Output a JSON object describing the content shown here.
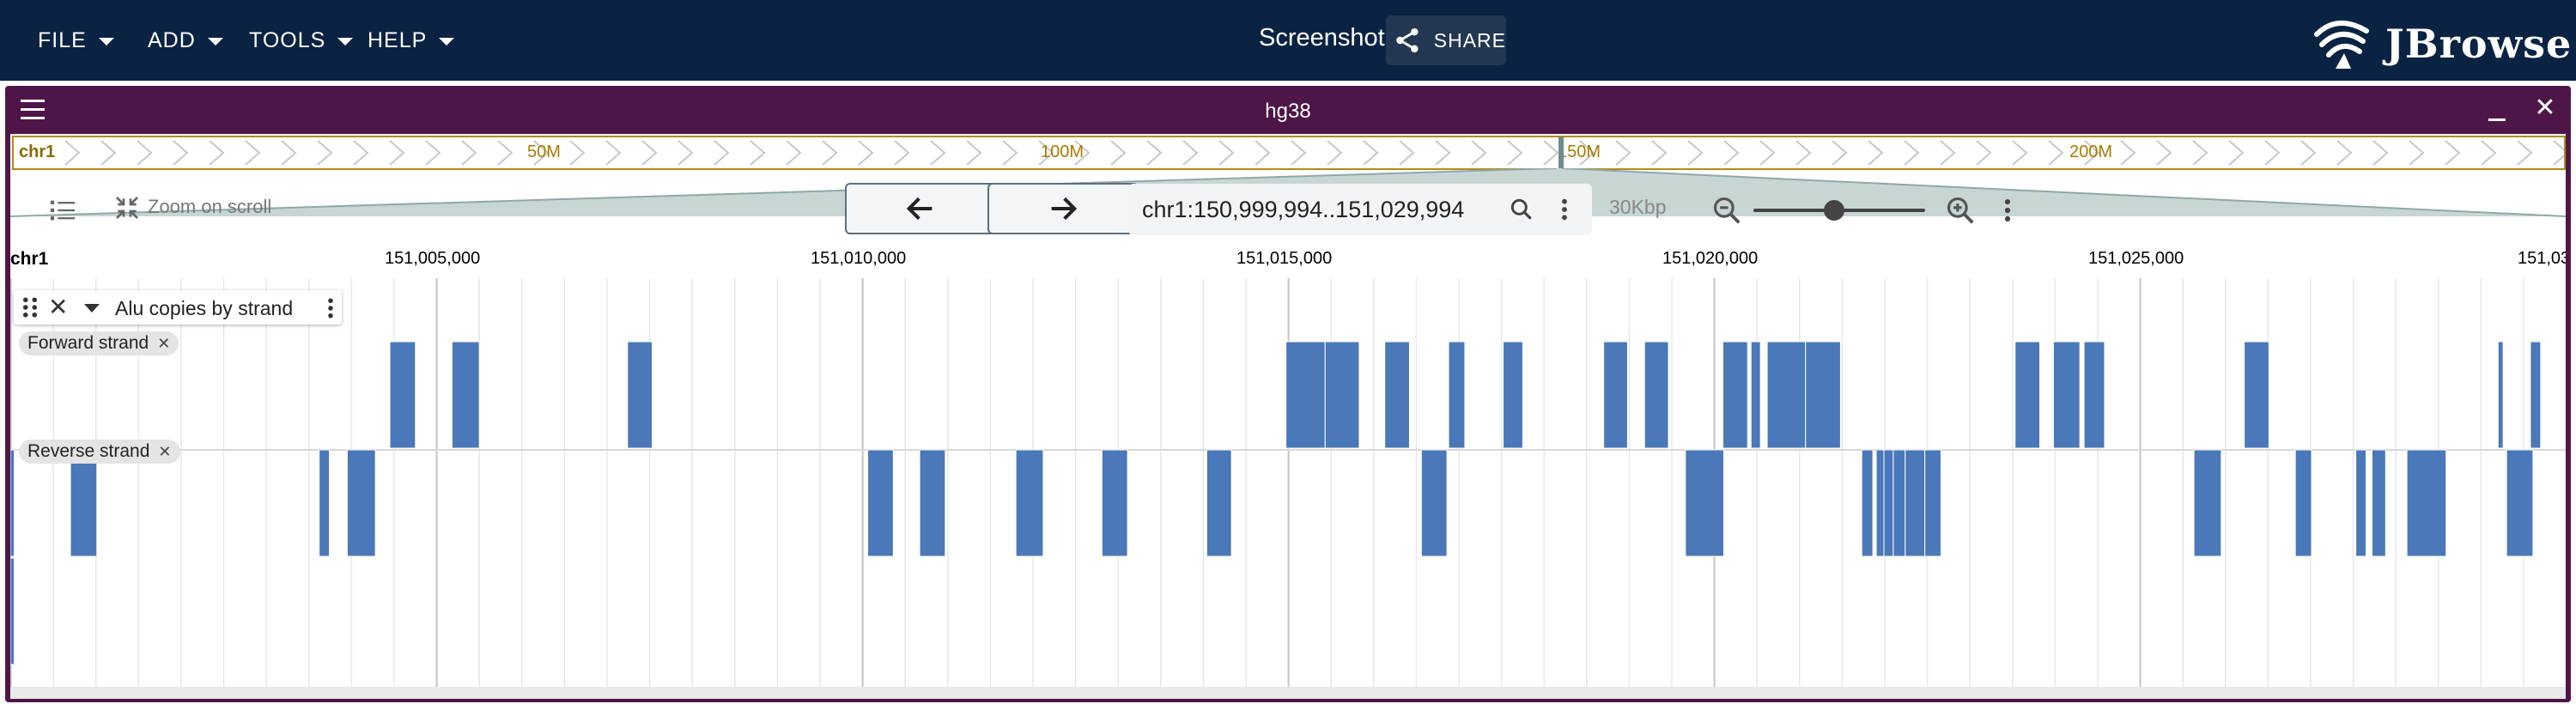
{
  "header": {
    "menus": [
      {
        "label": "FILE",
        "name": "file-menu"
      },
      {
        "label": "ADD",
        "name": "add-menu"
      },
      {
        "label": "TOOLS",
        "name": "tools-menu"
      },
      {
        "label": "HELP",
        "name": "help-menu"
      }
    ],
    "session_name": "Screenshot",
    "share_label": "SHARE",
    "logo_text": "JBrowse"
  },
  "view": {
    "assembly": "hg38",
    "overview": {
      "chr": "chr1",
      "ticks": [
        {
          "label": "50M",
          "pos": 50
        },
        {
          "label": "100M",
          "pos": 100
        },
        {
          "label": "150M",
          "pos": 150
        },
        {
          "label": "200M",
          "pos": 200
        }
      ]
    },
    "zoom_on_scroll_label": "Zoom on scroll",
    "location": "chr1:150,999,994..151,029,994",
    "bp_per_view_label": "30Kbp",
    "zoom_level": 0.42,
    "scale": {
      "chr": "chr1",
      "labels": [
        "151,005,000",
        "151,010,000",
        "151,015,000",
        "151,020,000",
        "151,025,000",
        "151,03"
      ]
    },
    "track": {
      "name": "Alu copies by strand",
      "feature_color": "#4a78b8",
      "subtracks": [
        {
          "label": "Forward strand"
        },
        {
          "label": "Reverse strand"
        }
      ]
    }
  },
  "colors": {
    "appbar": "#0b2343",
    "view_header": "#4e1648",
    "overview_border": "#b38b19",
    "feature": "#4a78b8"
  },
  "chart_data": {
    "type": "table",
    "xlim": [
      150999994,
      151029994
    ],
    "forward_features": [
      [
        151004450,
        151004750
      ],
      [
        151005180,
        151005500
      ],
      [
        151007240,
        151007530
      ],
      [
        151014970,
        151015430
      ],
      [
        151015430,
        151015830
      ],
      [
        151016130,
        151016420
      ],
      [
        151016880,
        151017070
      ],
      [
        151017520,
        151017750
      ],
      [
        151018700,
        151018980
      ],
      [
        151019180,
        151019460
      ],
      [
        151020100,
        151020390
      ],
      [
        151020430,
        151020540
      ],
      [
        151020620,
        151021070
      ],
      [
        151021070,
        151021480
      ],
      [
        151023530,
        151023820
      ],
      [
        151023980,
        151024290
      ],
      [
        151024340,
        151024580
      ],
      [
        151026220,
        151026510
      ],
      [
        151029200,
        151029260
      ],
      [
        151029580,
        151029700
      ]
    ],
    "reverse_features": [
      [
        150999994,
        151000040
      ],
      [
        151000700,
        151001010
      ],
      [
        151003620,
        151003740
      ],
      [
        151003950,
        151004280
      ],
      [
        151010060,
        151010360
      ],
      [
        151010670,
        151010970
      ],
      [
        151011800,
        151012120
      ],
      [
        151012810,
        151013110
      ],
      [
        151014040,
        151014330
      ],
      [
        151016560,
        151016860
      ],
      [
        151019660,
        151020110
      ],
      [
        151021730,
        151021860
      ],
      [
        151021900,
        151021990
      ],
      [
        151021990,
        151022100
      ],
      [
        151022100,
        151022240
      ],
      [
        151022240,
        151022470
      ],
      [
        151022470,
        151022660
      ],
      [
        151025630,
        151025950
      ],
      [
        151026820,
        151027010
      ],
      [
        151027530,
        151027650
      ],
      [
        151027720,
        151027880
      ],
      [
        151028130,
        151028590
      ],
      [
        151029300,
        151029610
      ]
    ],
    "extra_row_features": [
      [
        150999994,
        151000040
      ]
    ]
  }
}
